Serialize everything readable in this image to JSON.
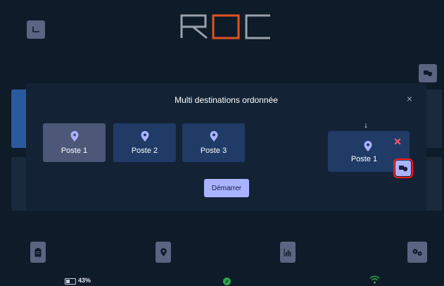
{
  "app": {
    "logo_text": "ROC"
  },
  "modal": {
    "title": "Multi destinations ordonnée",
    "close_symbol": "×",
    "destinations": [
      {
        "label": "Poste 1",
        "selected": true
      },
      {
        "label": "Poste 2",
        "selected": false
      },
      {
        "label": "Poste 3",
        "selected": false
      }
    ],
    "start_label": "Démarrer",
    "queue": {
      "arrow_symbol": "↓",
      "items": [
        {
          "label": "Poste 1",
          "remove_symbol": "✕"
        }
      ]
    }
  },
  "status_bar": {
    "battery_percent": "43%",
    "battery_level": 0.43
  },
  "colors": {
    "accent": "#aab3ff",
    "card": "#1f3b66",
    "card_selected": "#4d5878",
    "logo_orange": "#e0531f",
    "remove_red": "#ff5b6e",
    "status_green": "#2ea84a"
  },
  "icons": [
    "back-corner-icon",
    "swap-icon",
    "location-pin-icon",
    "clipboard-icon",
    "chart-icon",
    "settings-gears-icon",
    "battery-icon",
    "leaf-icon",
    "wifi-icon"
  ]
}
